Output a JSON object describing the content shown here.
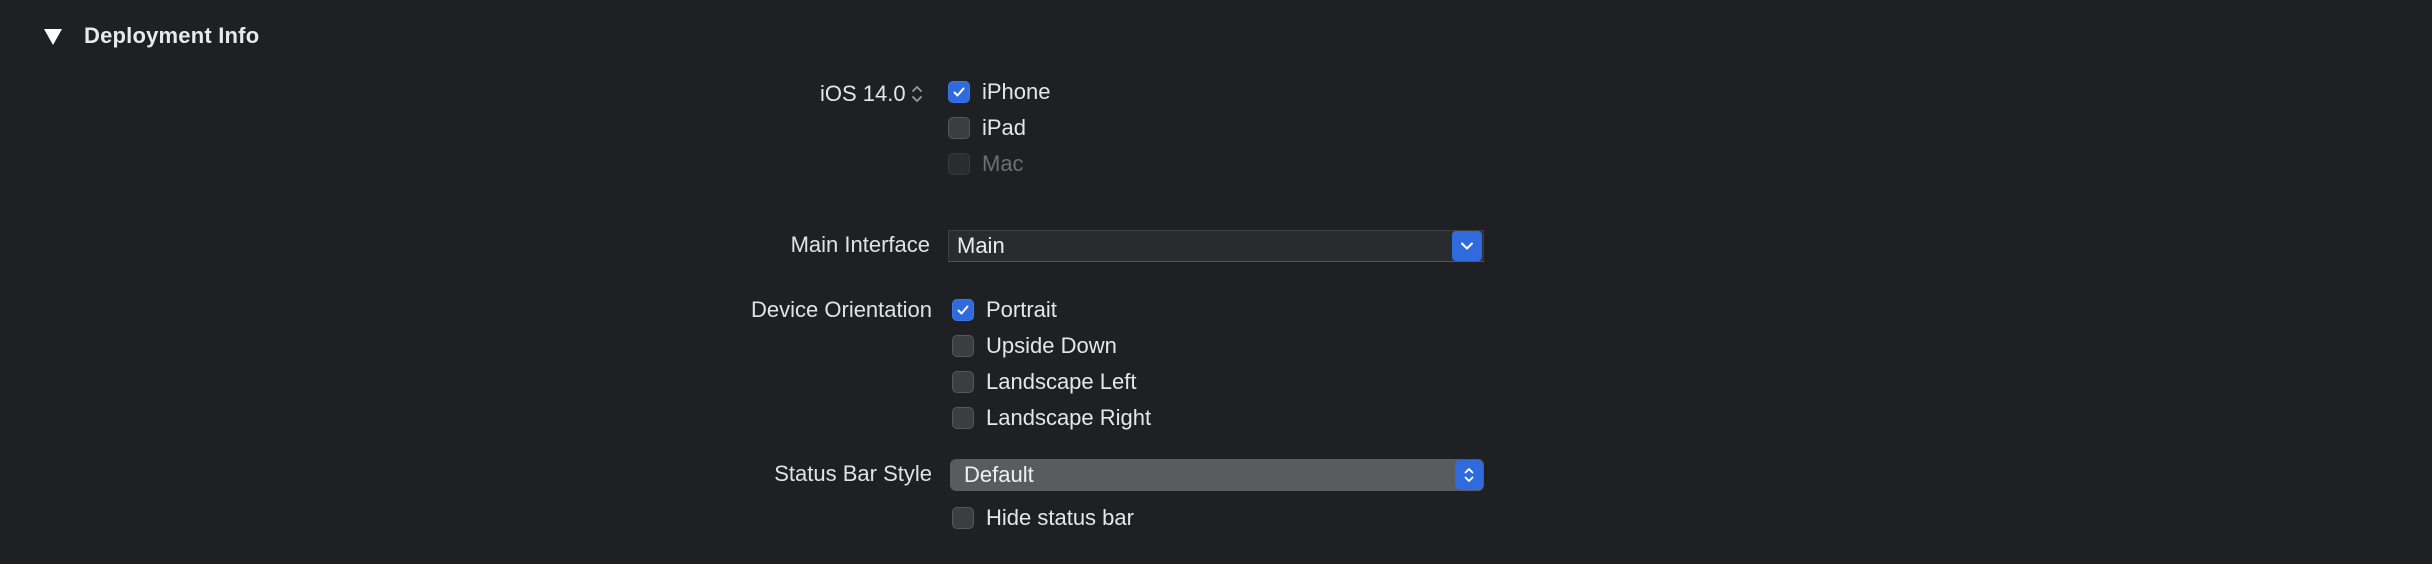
{
  "section": {
    "title": "Deployment Info"
  },
  "deployment_target": {
    "version": "iOS 14.0",
    "devices": [
      {
        "label": "iPhone",
        "checked": true,
        "enabled": true
      },
      {
        "label": "iPad",
        "checked": false,
        "enabled": true
      },
      {
        "label": "Mac",
        "checked": false,
        "enabled": false
      }
    ]
  },
  "main_interface": {
    "label": "Main Interface",
    "value": "Main"
  },
  "device_orientation": {
    "label": "Device Orientation",
    "options": [
      {
        "label": "Portrait",
        "checked": true
      },
      {
        "label": "Upside Down",
        "checked": false
      },
      {
        "label": "Landscape Left",
        "checked": false
      },
      {
        "label": "Landscape Right",
        "checked": false
      }
    ]
  },
  "status_bar": {
    "label": "Status Bar Style",
    "value": "Default",
    "hide_label": "Hide status bar",
    "hide_checked": false
  },
  "colors": {
    "background": "#1f2023",
    "accent": "#2f6bdc",
    "disabled_text": "#6e6e72"
  },
  "icons": {
    "disclosure": "disclosure-triangle-down-icon",
    "stepper": "up-down-chevron-icon",
    "checkmark": "checkmark-icon",
    "combo": "chevron-down-icon",
    "popup": "up-down-chevron-icon"
  }
}
